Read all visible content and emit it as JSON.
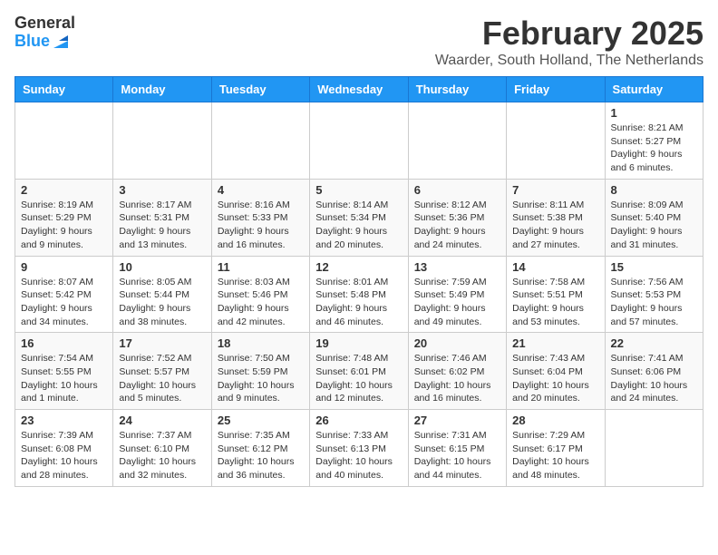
{
  "header": {
    "logo_general": "General",
    "logo_blue": "Blue",
    "month": "February 2025",
    "location": "Waarder, South Holland, The Netherlands"
  },
  "days_of_week": [
    "Sunday",
    "Monday",
    "Tuesday",
    "Wednesday",
    "Thursday",
    "Friday",
    "Saturday"
  ],
  "weeks": [
    [
      {
        "day": "",
        "info": ""
      },
      {
        "day": "",
        "info": ""
      },
      {
        "day": "",
        "info": ""
      },
      {
        "day": "",
        "info": ""
      },
      {
        "day": "",
        "info": ""
      },
      {
        "day": "",
        "info": ""
      },
      {
        "day": "1",
        "info": "Sunrise: 8:21 AM\nSunset: 5:27 PM\nDaylight: 9 hours and 6 minutes."
      }
    ],
    [
      {
        "day": "2",
        "info": "Sunrise: 8:19 AM\nSunset: 5:29 PM\nDaylight: 9 hours and 9 minutes."
      },
      {
        "day": "3",
        "info": "Sunrise: 8:17 AM\nSunset: 5:31 PM\nDaylight: 9 hours and 13 minutes."
      },
      {
        "day": "4",
        "info": "Sunrise: 8:16 AM\nSunset: 5:33 PM\nDaylight: 9 hours and 16 minutes."
      },
      {
        "day": "5",
        "info": "Sunrise: 8:14 AM\nSunset: 5:34 PM\nDaylight: 9 hours and 20 minutes."
      },
      {
        "day": "6",
        "info": "Sunrise: 8:12 AM\nSunset: 5:36 PM\nDaylight: 9 hours and 24 minutes."
      },
      {
        "day": "7",
        "info": "Sunrise: 8:11 AM\nSunset: 5:38 PM\nDaylight: 9 hours and 27 minutes."
      },
      {
        "day": "8",
        "info": "Sunrise: 8:09 AM\nSunset: 5:40 PM\nDaylight: 9 hours and 31 minutes."
      }
    ],
    [
      {
        "day": "9",
        "info": "Sunrise: 8:07 AM\nSunset: 5:42 PM\nDaylight: 9 hours and 34 minutes."
      },
      {
        "day": "10",
        "info": "Sunrise: 8:05 AM\nSunset: 5:44 PM\nDaylight: 9 hours and 38 minutes."
      },
      {
        "day": "11",
        "info": "Sunrise: 8:03 AM\nSunset: 5:46 PM\nDaylight: 9 hours and 42 minutes."
      },
      {
        "day": "12",
        "info": "Sunrise: 8:01 AM\nSunset: 5:48 PM\nDaylight: 9 hours and 46 minutes."
      },
      {
        "day": "13",
        "info": "Sunrise: 7:59 AM\nSunset: 5:49 PM\nDaylight: 9 hours and 49 minutes."
      },
      {
        "day": "14",
        "info": "Sunrise: 7:58 AM\nSunset: 5:51 PM\nDaylight: 9 hours and 53 minutes."
      },
      {
        "day": "15",
        "info": "Sunrise: 7:56 AM\nSunset: 5:53 PM\nDaylight: 9 hours and 57 minutes."
      }
    ],
    [
      {
        "day": "16",
        "info": "Sunrise: 7:54 AM\nSunset: 5:55 PM\nDaylight: 10 hours and 1 minute."
      },
      {
        "day": "17",
        "info": "Sunrise: 7:52 AM\nSunset: 5:57 PM\nDaylight: 10 hours and 5 minutes."
      },
      {
        "day": "18",
        "info": "Sunrise: 7:50 AM\nSunset: 5:59 PM\nDaylight: 10 hours and 9 minutes."
      },
      {
        "day": "19",
        "info": "Sunrise: 7:48 AM\nSunset: 6:01 PM\nDaylight: 10 hours and 12 minutes."
      },
      {
        "day": "20",
        "info": "Sunrise: 7:46 AM\nSunset: 6:02 PM\nDaylight: 10 hours and 16 minutes."
      },
      {
        "day": "21",
        "info": "Sunrise: 7:43 AM\nSunset: 6:04 PM\nDaylight: 10 hours and 20 minutes."
      },
      {
        "day": "22",
        "info": "Sunrise: 7:41 AM\nSunset: 6:06 PM\nDaylight: 10 hours and 24 minutes."
      }
    ],
    [
      {
        "day": "23",
        "info": "Sunrise: 7:39 AM\nSunset: 6:08 PM\nDaylight: 10 hours and 28 minutes."
      },
      {
        "day": "24",
        "info": "Sunrise: 7:37 AM\nSunset: 6:10 PM\nDaylight: 10 hours and 32 minutes."
      },
      {
        "day": "25",
        "info": "Sunrise: 7:35 AM\nSunset: 6:12 PM\nDaylight: 10 hours and 36 minutes."
      },
      {
        "day": "26",
        "info": "Sunrise: 7:33 AM\nSunset: 6:13 PM\nDaylight: 10 hours and 40 minutes."
      },
      {
        "day": "27",
        "info": "Sunrise: 7:31 AM\nSunset: 6:15 PM\nDaylight: 10 hours and 44 minutes."
      },
      {
        "day": "28",
        "info": "Sunrise: 7:29 AM\nSunset: 6:17 PM\nDaylight: 10 hours and 48 minutes."
      },
      {
        "day": "",
        "info": ""
      }
    ]
  ]
}
